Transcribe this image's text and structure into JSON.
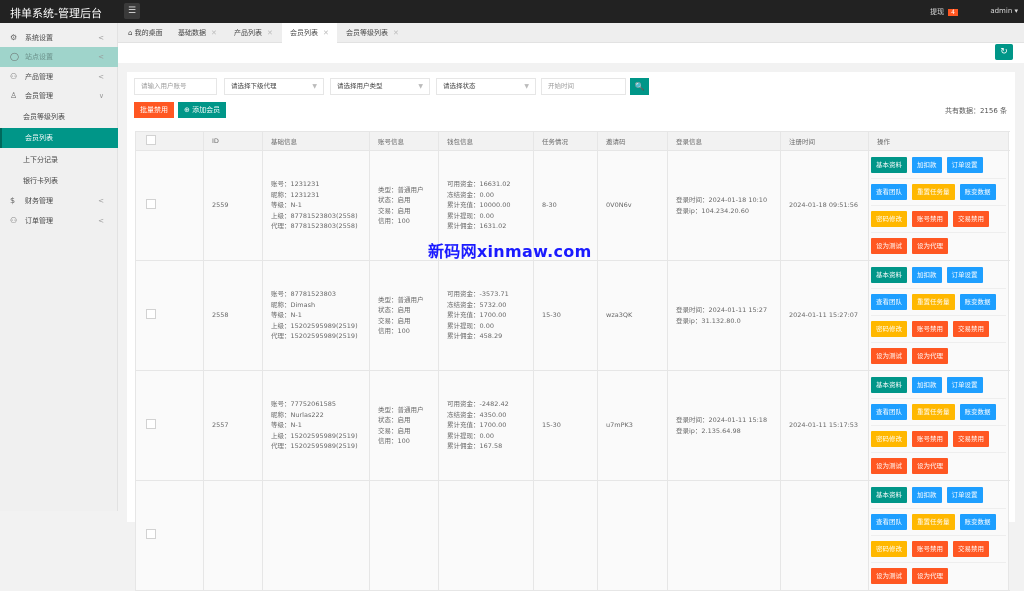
{
  "header": {
    "title": "排单系统-管理后台",
    "menu_icon": "☰",
    "tip_label": "提现",
    "tip_count": "4",
    "user": "admin ▾"
  },
  "sidebar": [
    {
      "icon": "⚙",
      "label": "系统设置",
      "arrow": "<",
      "type": "top"
    },
    {
      "icon": "◯",
      "label": "站点设置",
      "arrow": "<",
      "type": "hl"
    },
    {
      "icon": "⚇",
      "label": "产品管理",
      "arrow": "<",
      "type": "top"
    },
    {
      "icon": "♙",
      "label": "会员管理",
      "arrow": "∨",
      "type": "top"
    },
    {
      "label": "会员等级列表",
      "type": "sub"
    },
    {
      "label": "会员列表",
      "type": "act"
    },
    {
      "label": "上下分记录",
      "type": "sub"
    },
    {
      "label": "银行卡列表",
      "type": "sub"
    },
    {
      "icon": "$",
      "label": "财务管理",
      "arrow": "<",
      "type": "top"
    },
    {
      "icon": "⚇",
      "label": "订单管理",
      "arrow": "<",
      "type": "top"
    }
  ],
  "tabs": [
    {
      "label": "⌂ 我的桌面"
    },
    {
      "label": "基础数据",
      "close": "✕"
    },
    {
      "label": "产品列表",
      "close": "✕"
    },
    {
      "label": "会员列表",
      "close": "✕",
      "active": true
    },
    {
      "label": "会员等级列表",
      "close": "✕"
    }
  ],
  "filters": {
    "account_placeholder": "请输入用户账号",
    "agent": "请选择下级代理",
    "user_type": "请选择用户类型",
    "status": "请选择状态",
    "start_placeholder": "开始时间",
    "search_icon": "🔍",
    "refresh_icon": "↻"
  },
  "actions": {
    "batch_disable": "批量禁用",
    "add_member": "⊕ 添加会员",
    "total": "共有数据：2156 条"
  },
  "columns": [
    "ID",
    "基础信息",
    "账号信息",
    "钱包信息",
    "任务情况",
    "邀请码",
    "登录信息",
    "注册时间",
    "操作"
  ],
  "rows": [
    {
      "id": "2559",
      "basic": [
        "账号：1231231",
        "昵称：1231231",
        "等级：N-1",
        "上级：87781523803(2558)",
        "代理：87781523803(2558)"
      ],
      "account": [
        "类型：普通用户",
        "状态：启用",
        "交易：启用",
        "信用：100"
      ],
      "wallet": [
        "可用资金：16631.02",
        "冻结资金：0.00",
        "累计充值：10000.00",
        "累计提现：0.00",
        "累计佣金：1631.02"
      ],
      "task": "8-30",
      "invite": "0V0N6v",
      "login": [
        "登录时间：2024-01-18 10:10",
        "登录ip：104.234.20.60"
      ],
      "reg": "2024-01-18 09:51:56"
    },
    {
      "id": "2558",
      "basic": [
        "账号：87781523803",
        "昵称：Dimash",
        "等级：N-1",
        "上级：15202595989(2519)",
        "代理：15202595989(2519)"
      ],
      "account": [
        "类型：普通用户",
        "状态：启用",
        "交易：启用",
        "信用：100"
      ],
      "wallet": [
        "可用资金：-3573.71",
        "冻结资金：5732.00",
        "累计充值：1700.00",
        "累计提现：0.00",
        "累计佣金：458.29"
      ],
      "task": "15-30",
      "invite": "wza3QK",
      "login": [
        "登录时间：2024-01-11 15:27",
        "登录ip：31.132.80.0"
      ],
      "reg": "2024-01-11 15:27:07"
    },
    {
      "id": "2557",
      "basic": [
        "账号：77752061585",
        "昵称：Nurlas222",
        "等级：N-1",
        "上级：15202595989(2519)",
        "代理：15202595989(2519)"
      ],
      "account": [
        "类型：普通用户",
        "状态：启用",
        "交易：启用",
        "信用：100"
      ],
      "wallet": [
        "可用资金：-2482.42",
        "冻结资金：4350.00",
        "累计充值：1700.00",
        "累计提现：0.00",
        "累计佣金：167.58"
      ],
      "task": "15-30",
      "invite": "u7mPK3",
      "login": [
        "登录时间：2024-01-11 15:18",
        "登录ip：2.135.64.98"
      ],
      "reg": "2024-01-11 15:17:53"
    },
    {
      "id": "",
      "basic": [],
      "account": [],
      "wallet": [],
      "task": "",
      "invite": "",
      "login": [],
      "reg": ""
    }
  ],
  "op_buttons": [
    [
      {
        "label": "基本资料",
        "color": "#009688"
      },
      {
        "label": "加扣款",
        "color": "#1e9fff"
      },
      {
        "label": "订单设置",
        "color": "#1e9fff"
      }
    ],
    [
      {
        "label": "查看团队",
        "color": "#1e9fff"
      },
      {
        "label": "重置任务量",
        "color": "#ffb800"
      },
      {
        "label": "账变数据",
        "color": "#1e9fff"
      }
    ],
    [
      {
        "label": "密码修改",
        "color": "#ffb800"
      },
      {
        "label": "账号禁用",
        "color": "#ff5722"
      },
      {
        "label": "交易禁用",
        "color": "#ff5722"
      }
    ],
    [
      {
        "label": "设为测试",
        "color": "#ff5722"
      },
      {
        "label": "设为代理",
        "color": "#ff5722"
      }
    ]
  ],
  "watermark": "新码网xinmaw.com"
}
